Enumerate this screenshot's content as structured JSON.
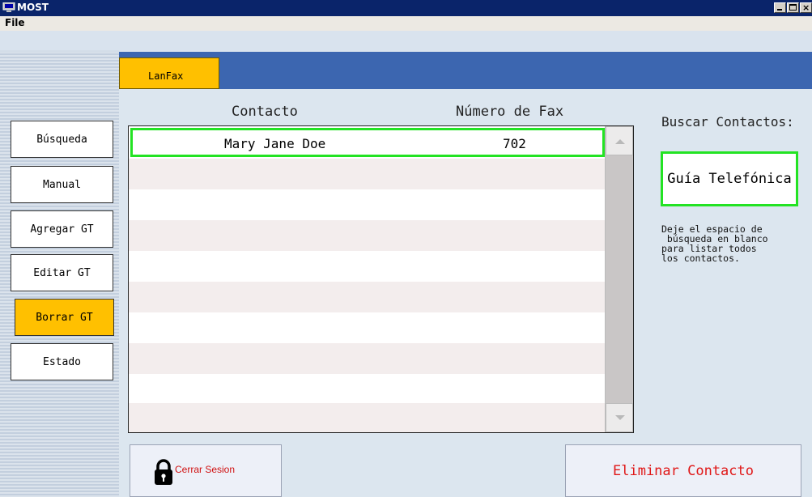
{
  "window": {
    "title": "MOST"
  },
  "menu": {
    "file": "File"
  },
  "colors": {
    "accent": "#ffc000",
    "tab_bar": "#3c66b0",
    "highlight": "#23e323",
    "danger": "#e01818"
  },
  "sidebar": {
    "items": [
      {
        "label": "Búsqueda",
        "active": false
      },
      {
        "label": "Manual",
        "active": false
      },
      {
        "label": "Agregar GT",
        "active": false
      },
      {
        "label": "Editar GT",
        "active": false
      },
      {
        "label": "Borrar GT",
        "active": true
      },
      {
        "label": "Estado",
        "active": false
      }
    ]
  },
  "tabs": [
    {
      "label": "LanFax",
      "active": true
    }
  ],
  "table": {
    "headers": {
      "contact": "Contacto",
      "fax": "Número de Fax"
    },
    "rows": [
      {
        "contact": "Mary Jane Doe",
        "fax": "702"
      }
    ]
  },
  "search": {
    "label": "Buscar Contactos:",
    "phonebook_button": "Guía Telefónica",
    "hint": "Deje el espacio de\n búsqueda en blanco\npara listar todos\nlos contactos."
  },
  "actions": {
    "logout": "Cerrar Sesion",
    "delete_contact": "Eliminar Contacto"
  },
  "icons": {
    "app": "monitor-icon",
    "logout": "lock-icon",
    "scroll_up": "triangle-up-icon",
    "scroll_down": "triangle-down-icon"
  }
}
